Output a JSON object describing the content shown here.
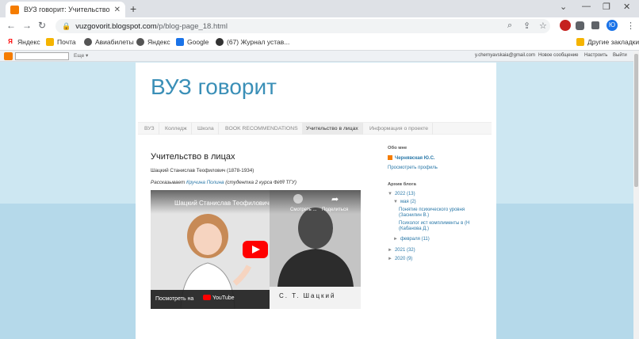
{
  "browser": {
    "tab_title": "ВУЗ говорит: Учительство в лиц",
    "url_host": "vuzgovorit.blogspot.com",
    "url_path": "/p/blog-page_18.html",
    "profile_initial": "Ю"
  },
  "bookmarks": {
    "items": [
      "Яндекс",
      "Почта",
      "Авиабилеты",
      "Яндекс",
      "Google",
      "(67) Журнал устав..."
    ],
    "other": "Другие закладки"
  },
  "blogger_nav": {
    "next": "Еще ▾",
    "email": "y.chernyavskaia@gmail.com",
    "new_post": "Новое сообщение",
    "design": "Настроить",
    "signout": "Выйти"
  },
  "blog": {
    "title": "ВУЗ говорит",
    "tabs": [
      "ВУЗ",
      "Колледж",
      "Школа",
      "BOOK RECOMMENDATIONS",
      "Учительство в лицах",
      "Информация о проекте"
    ],
    "active_tab": 4
  },
  "post": {
    "title": "Учительство в лицах",
    "person": "Шацкий Станислав Теофилович (1878-1934)",
    "author_prefix": "Рассказывает ",
    "author_name": "Кручина Полина",
    "author_suffix": " (студентка 2 курса ФИЯ ТГУ)"
  },
  "video": {
    "title": "Шацкий Станислав Теофилович",
    "watch_later": "Смотреть ...",
    "share": "Поделиться",
    "watch_on": "Посмотреть на",
    "youtube": "YouTube",
    "caption": "С. Т. Шацкий"
  },
  "sidebar": {
    "about_heading": "Обо мне",
    "profile_name": "Чернявская Ю.С.",
    "view_profile": "Просмотреть профиль",
    "archive_heading": "Архив блога",
    "year_2022": "2022 (13)",
    "may": "мая (2)",
    "post1_line1": "Понятие психического уровня",
    "post1_line2": "(Заснилин В.)",
    "post2_line1": "Психолог ист комплименты в (Н",
    "post2_line2": "(Кабанова Д.)",
    "february": "февраля (11)",
    "year_2021": "2021 (32)",
    "year_2020": "2020 (9)"
  },
  "colors": {
    "title_blue": "#3a8fb7",
    "link_blue": "#2a78a8",
    "blogger_orange": "#f57c00",
    "page_bg": "#cde7f2"
  }
}
